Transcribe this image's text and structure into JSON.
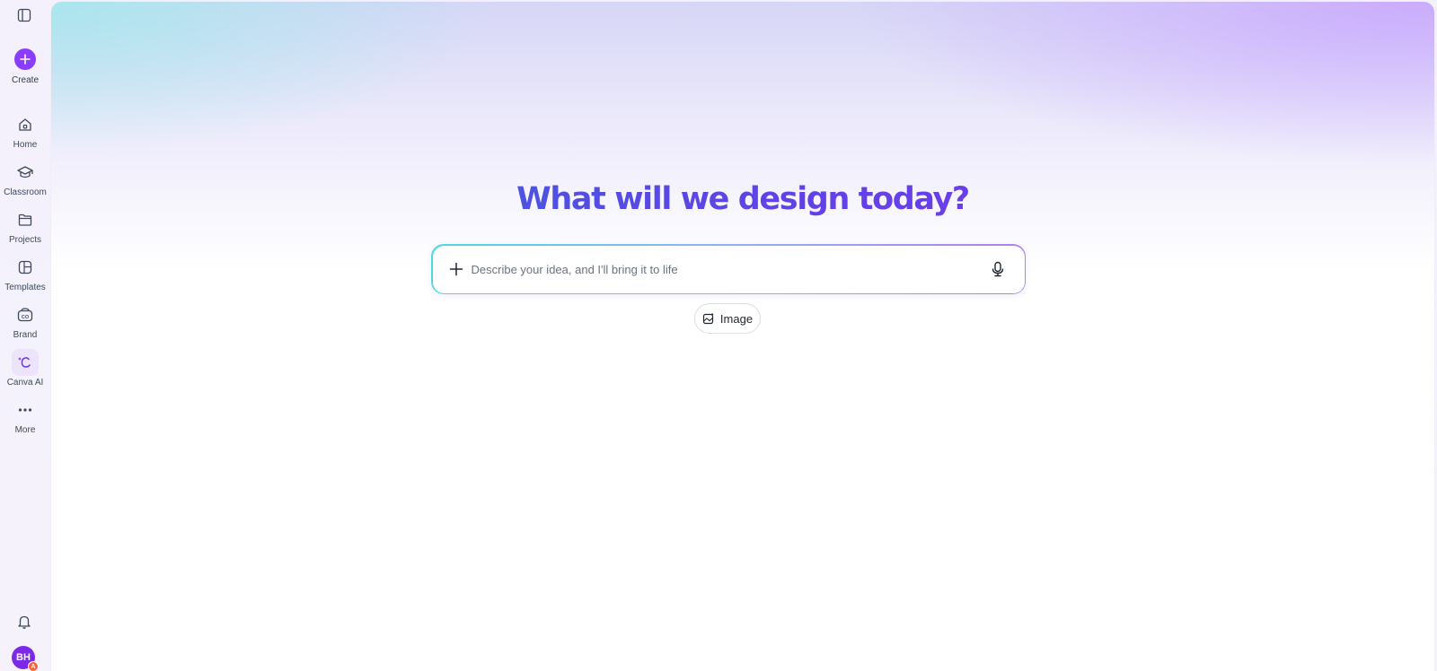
{
  "sidebar": {
    "toggle_icon": "sidebar-panel-icon",
    "create": {
      "label": "Create",
      "icon": "plus-icon",
      "color": "#8b3dff"
    },
    "items": [
      {
        "label": "Home",
        "icon": "home-icon",
        "active": false
      },
      {
        "label": "Classroom",
        "icon": "graduation-cap-icon",
        "active": false
      },
      {
        "label": "Projects",
        "icon": "folder-icon",
        "active": false
      },
      {
        "label": "Templates",
        "icon": "templates-icon",
        "active": false
      },
      {
        "label": "Brand",
        "icon": "brand-icon",
        "active": false
      },
      {
        "label": "Canva AI",
        "icon": "canva-ai-icon",
        "active": true
      },
      {
        "label": "More",
        "icon": "more-dots-icon",
        "active": false
      }
    ],
    "notifications_icon": "bell-icon",
    "avatar": {
      "initials": "BH",
      "badge": "A",
      "color": "#7d2ae8"
    }
  },
  "main": {
    "headline": "What will we design today?",
    "prompt": {
      "placeholder": "Describe your idea, and I'll bring it to life",
      "value": "",
      "add_icon": "plus-icon",
      "mic_icon": "microphone-icon"
    },
    "chips": [
      {
        "label": "Image",
        "icon": "image-sparkle-icon"
      }
    ]
  },
  "colors": {
    "accent": "#8b3dff",
    "headline_start": "#2b6fd6",
    "headline_end": "#7a3ceb"
  }
}
